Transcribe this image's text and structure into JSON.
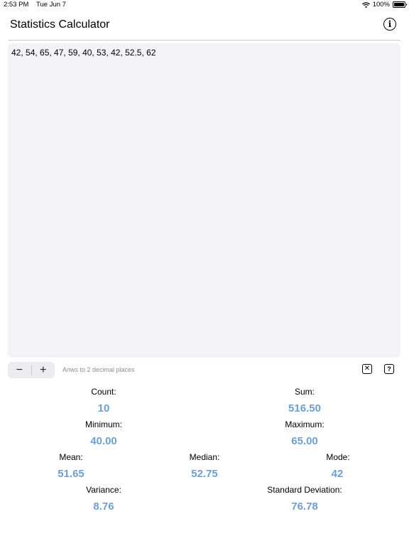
{
  "status_bar": {
    "time": "2:53 PM",
    "date": "Tue Jun 7",
    "battery": "100%"
  },
  "nav": {
    "title": "Statistics Calculator",
    "info_icon": "info-circle-icon"
  },
  "input": {
    "text": "42, 54, 65, 47, 59, 40, 53, 42, 52.5, 62"
  },
  "controls": {
    "minus": "−",
    "plus": "+",
    "decimals_label": "Anws to 2 decimal places",
    "clear_symbol": "✕",
    "help_symbol": "?"
  },
  "stats": {
    "count": {
      "label": "Count:",
      "value": "10"
    },
    "sum": {
      "label": "Sum:",
      "value": "516.50"
    },
    "minimum": {
      "label": "Minimum:",
      "value": "40.00"
    },
    "maximum": {
      "label": "Maximum:",
      "value": "65.00"
    },
    "mean": {
      "label": "Mean:",
      "value": "51.65"
    },
    "median": {
      "label": "Median:",
      "value": "52.75"
    },
    "mode": {
      "label": "Mode:",
      "value": "42"
    },
    "variance": {
      "label": "Variance:",
      "value": "8.76"
    },
    "std_dev": {
      "label": "Standard Deviation:",
      "value": "76.78"
    }
  },
  "colors": {
    "value_blue": "#6f9fd0",
    "text_area_bg": "#f2f2f7"
  }
}
